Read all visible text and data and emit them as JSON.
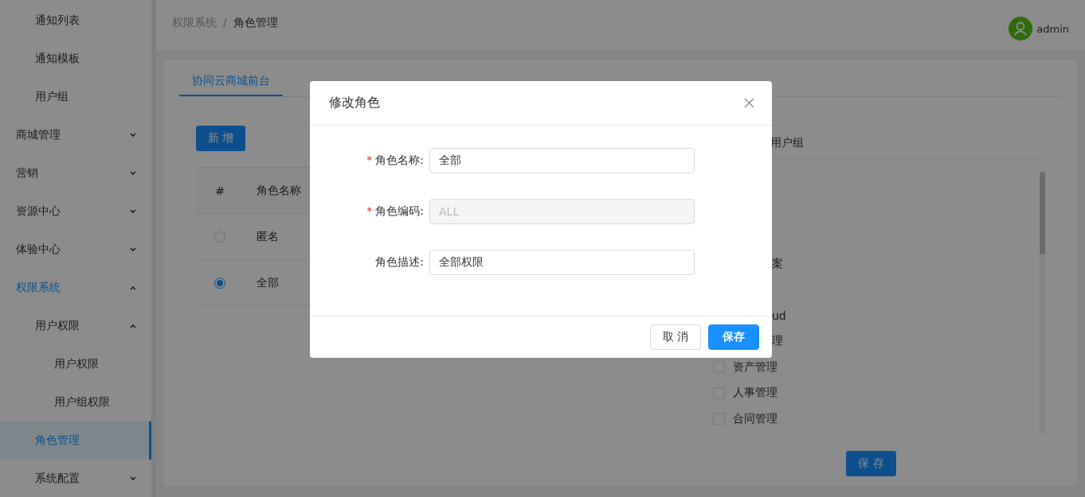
{
  "sidebar": {
    "items": [
      {
        "children": [
          {
            "label": "通知列表",
            "selected": false
          },
          {
            "label": "通知模板",
            "selected": false
          },
          {
            "label": "用户组",
            "selected": false
          }
        ]
      },
      {
        "label": "商城管理",
        "expanded": false
      },
      {
        "label": "营销",
        "expanded": false
      },
      {
        "label": "资源中心",
        "expanded": false
      },
      {
        "label": "体验中心",
        "expanded": false
      },
      {
        "label": "权限系统",
        "expanded": true,
        "children": [
          {
            "label": "用户权限",
            "expanded": true,
            "children": [
              {
                "label": "用户权限",
                "selected": false
              },
              {
                "label": "用户组权限",
                "selected": false
              }
            ]
          },
          {
            "label": "角色管理",
            "selected": true
          },
          {
            "label": "系统配置",
            "expanded": false
          }
        ]
      }
    ]
  },
  "breadcrumb": [
    "权限系统",
    "角色管理"
  ],
  "breadcrumb_separator": "/",
  "user": {
    "name": "admin"
  },
  "tabs": [
    {
      "label": "协同云商城前台",
      "selected": true
    }
  ],
  "add_button": "新 增",
  "table": {
    "columns": [
      "#",
      "角色名称"
    ],
    "rows": [
      {
        "name": "匿名",
        "selected": false
      },
      {
        "name": "全部",
        "selected": true
      }
    ]
  },
  "right_panel": {
    "tab": "用户组",
    "items": [
      {
        "kind": "partial",
        "label": "案"
      },
      {
        "kind": "partial",
        "label": "ud"
      },
      {
        "kind": "partial",
        "label": "理"
      },
      {
        "kind": "checkbox",
        "label": "资产管理",
        "checked": false
      },
      {
        "kind": "checkbox",
        "label": "人事管理",
        "checked": false
      },
      {
        "kind": "checkbox",
        "label": "合同管理",
        "checked": false
      }
    ],
    "save_button": "保 存"
  },
  "dialog": {
    "title": "修改角色",
    "required_mark": "*",
    "fields": [
      {
        "label": "角色名称:",
        "value": "全部",
        "required": true,
        "disabled": false
      },
      {
        "label": "角色编码:",
        "value": "ALL",
        "required": true,
        "disabled": true
      },
      {
        "label": "角色描述:",
        "value": "全部权限",
        "required": false,
        "disabled": false
      }
    ],
    "buttons": [
      {
        "label": "取 消",
        "kind": "default"
      },
      {
        "label": "保存",
        "kind": "primary"
      }
    ]
  }
}
